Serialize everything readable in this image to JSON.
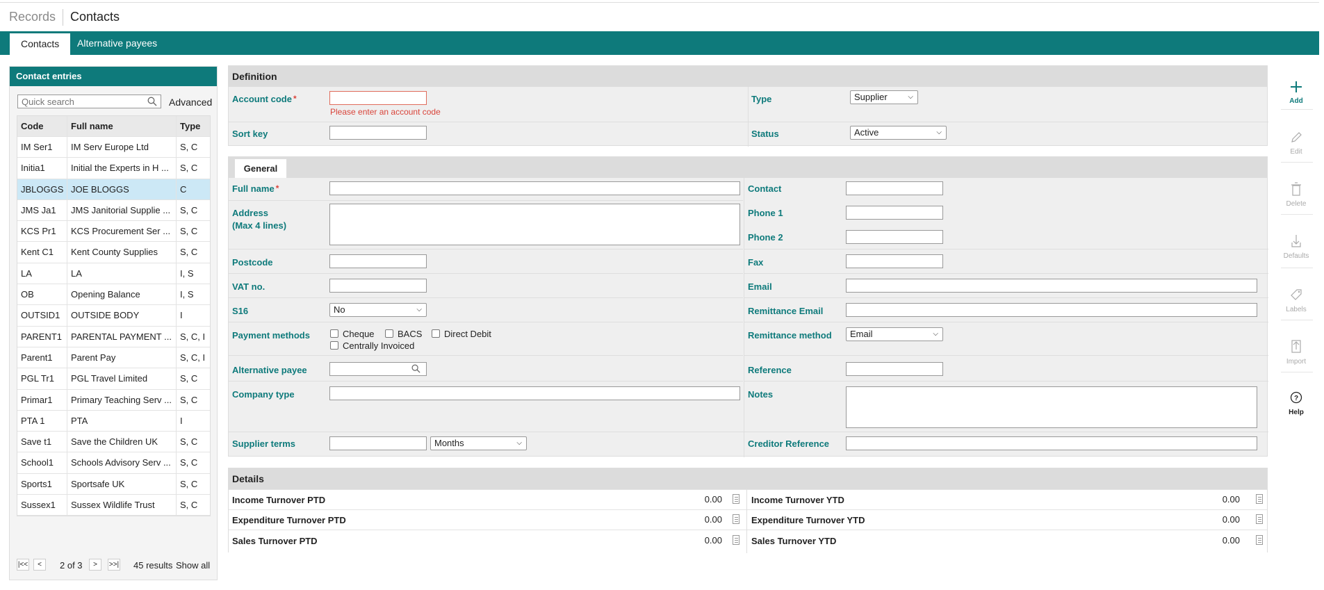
{
  "header": {
    "breadcrumb_root": "Records",
    "title": "Contacts"
  },
  "tabs": [
    {
      "label": "Contacts"
    },
    {
      "label": "Alternative payees"
    }
  ],
  "left_panel": {
    "title": "Contact entries",
    "search_placeholder": "Quick search",
    "advanced_label": "Advanced",
    "columns": [
      "Code",
      "Full name",
      "Type"
    ],
    "rows": [
      {
        "code": "IM Ser1",
        "name": "IM Serv Europe Ltd",
        "type": "S, C"
      },
      {
        "code": "Initia1",
        "name": "Initial the Experts in H ...",
        "type": "S, C"
      },
      {
        "code": "JBLOGGS",
        "name": "JOE BLOGGS",
        "type": "C"
      },
      {
        "code": "JMS Ja1",
        "name": "JMS Janitorial Supplie ...",
        "type": "S, C"
      },
      {
        "code": "KCS Pr1",
        "name": "KCS Procurement Ser ...",
        "type": "S, C"
      },
      {
        "code": "Kent C1",
        "name": "Kent County Supplies",
        "type": "S, C"
      },
      {
        "code": "LA",
        "name": "LA",
        "type": "I, S"
      },
      {
        "code": "OB",
        "name": "Opening Balance",
        "type": "I, S"
      },
      {
        "code": "OUTSID1",
        "name": "OUTSIDE BODY",
        "type": "I"
      },
      {
        "code": "PARENT1",
        "name": "PARENTAL PAYMENT ...",
        "type": "S, C, I"
      },
      {
        "code": "Parent1",
        "name": "Parent Pay",
        "type": "S, C, I"
      },
      {
        "code": "PGL Tr1",
        "name": "PGL Travel Limited",
        "type": "S, C"
      },
      {
        "code": "Primar1",
        "name": "Primary Teaching Serv ...",
        "type": "S, C"
      },
      {
        "code": "PTA 1",
        "name": "PTA",
        "type": "I"
      },
      {
        "code": "Save t1",
        "name": "Save the Children UK",
        "type": "S, C"
      },
      {
        "code": "School1",
        "name": "Schools Advisory Serv ...",
        "type": "S, C"
      },
      {
        "code": "Sports1",
        "name": "Sportsafe UK",
        "type": "S, C"
      },
      {
        "code": "Sussex1",
        "name": "Sussex Wildlife Trust",
        "type": "S, C"
      }
    ],
    "pager": {
      "page_text": "2 of 3",
      "results": "45 results",
      "show_all": "Show all"
    }
  },
  "definition": {
    "title": "Definition",
    "account_code_label": "Account code",
    "account_code_value": "",
    "account_code_error": "Please enter an account code",
    "sort_key_label": "Sort key",
    "type_label": "Type",
    "type_value": "Supplier",
    "status_label": "Status",
    "status_value": "Active"
  },
  "general": {
    "tab_label": "General",
    "full_name_label": "Full name",
    "address_label_1": "Address",
    "address_label_2": "(Max 4 lines)",
    "postcode_label": "Postcode",
    "vat_label": "VAT no.",
    "s16_label": "S16",
    "s16_value": "No",
    "payment_methods_label": "Payment methods",
    "payment_options": [
      "Cheque",
      "BACS",
      "Direct Debit",
      "Centrally Invoiced"
    ],
    "alt_payee_label": "Alternative payee",
    "company_type_label": "Company type",
    "supplier_terms_label": "Supplier terms",
    "supplier_terms_unit": "Months",
    "contact_label": "Contact",
    "phone1_label": "Phone 1",
    "phone2_label": "Phone 2",
    "fax_label": "Fax",
    "email_label": "Email",
    "remittance_email_label": "Remittance Email",
    "remittance_method_label": "Remittance method",
    "remittance_method_value": "Email",
    "reference_label": "Reference",
    "notes_label": "Notes",
    "creditor_ref_label": "Creditor Reference"
  },
  "details": {
    "title": "Details",
    "rows": [
      {
        "left_label": "Income Turnover PTD",
        "left_value": "0.00",
        "right_label": "Income Turnover YTD",
        "right_value": "0.00"
      },
      {
        "left_label": "Expenditure Turnover PTD",
        "left_value": "0.00",
        "right_label": "Expenditure Turnover YTD",
        "right_value": "0.00"
      },
      {
        "left_label": "Sales Turnover PTD",
        "left_value": "0.00",
        "right_label": "Sales Turnover YTD",
        "right_value": "0.00"
      }
    ]
  },
  "toolbar": {
    "add": "Add",
    "edit": "Edit",
    "delete": "Delete",
    "defaults": "Defaults",
    "labels": "Labels",
    "import": "Import",
    "help": "Help"
  },
  "colors": {
    "accent": "#0e7a7b",
    "error": "#d9443a",
    "selected_row": "#cce8f6"
  }
}
